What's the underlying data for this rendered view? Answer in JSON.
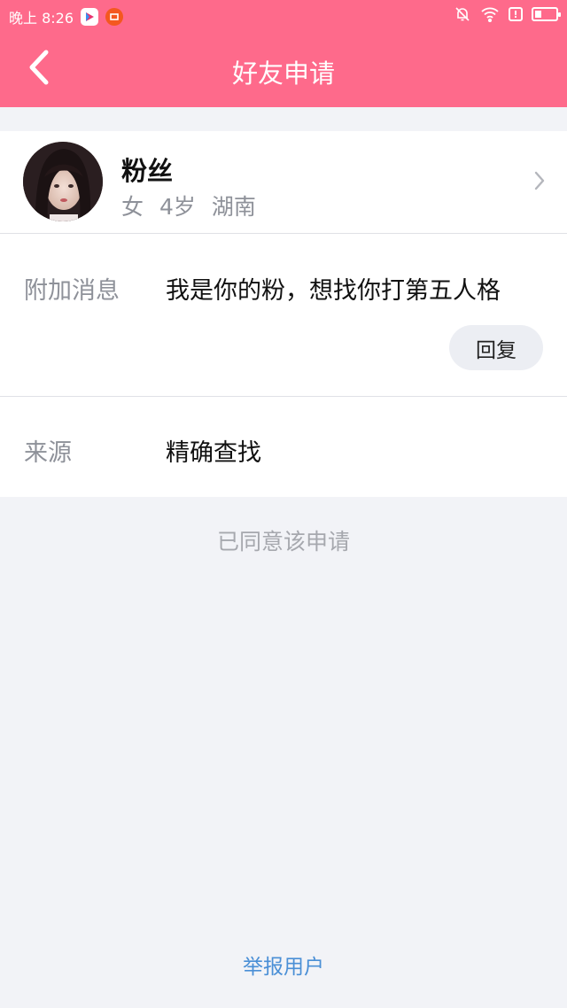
{
  "status_bar": {
    "time": "晚上 8:26",
    "alert_mark": "!",
    "battery_level": 0.3,
    "icons": [
      "video-app-icon",
      "orange-app-icon",
      "bell-muted-icon",
      "wifi-icon",
      "alert-icon",
      "battery-icon"
    ]
  },
  "header": {
    "title": "好友申请",
    "back_icon": "chevron-left-icon"
  },
  "profile": {
    "name": "粉丝",
    "gender": "女",
    "age": "4岁",
    "location": "湖南",
    "avatar_icon": "avatar-photo",
    "chevron_icon": "chevron-right-icon"
  },
  "message": {
    "label": "附加消息",
    "text": "我是你的粉，想找你打第五人格",
    "reply_label": "回复"
  },
  "source": {
    "label": "来源",
    "value": "精确查找"
  },
  "status_text": "已同意该申请",
  "report_label": "举报用户",
  "colors": {
    "accent": "#fe6a8b",
    "background": "#f2f3f7",
    "link": "#4a8fd6",
    "muted": "#8e9199"
  }
}
